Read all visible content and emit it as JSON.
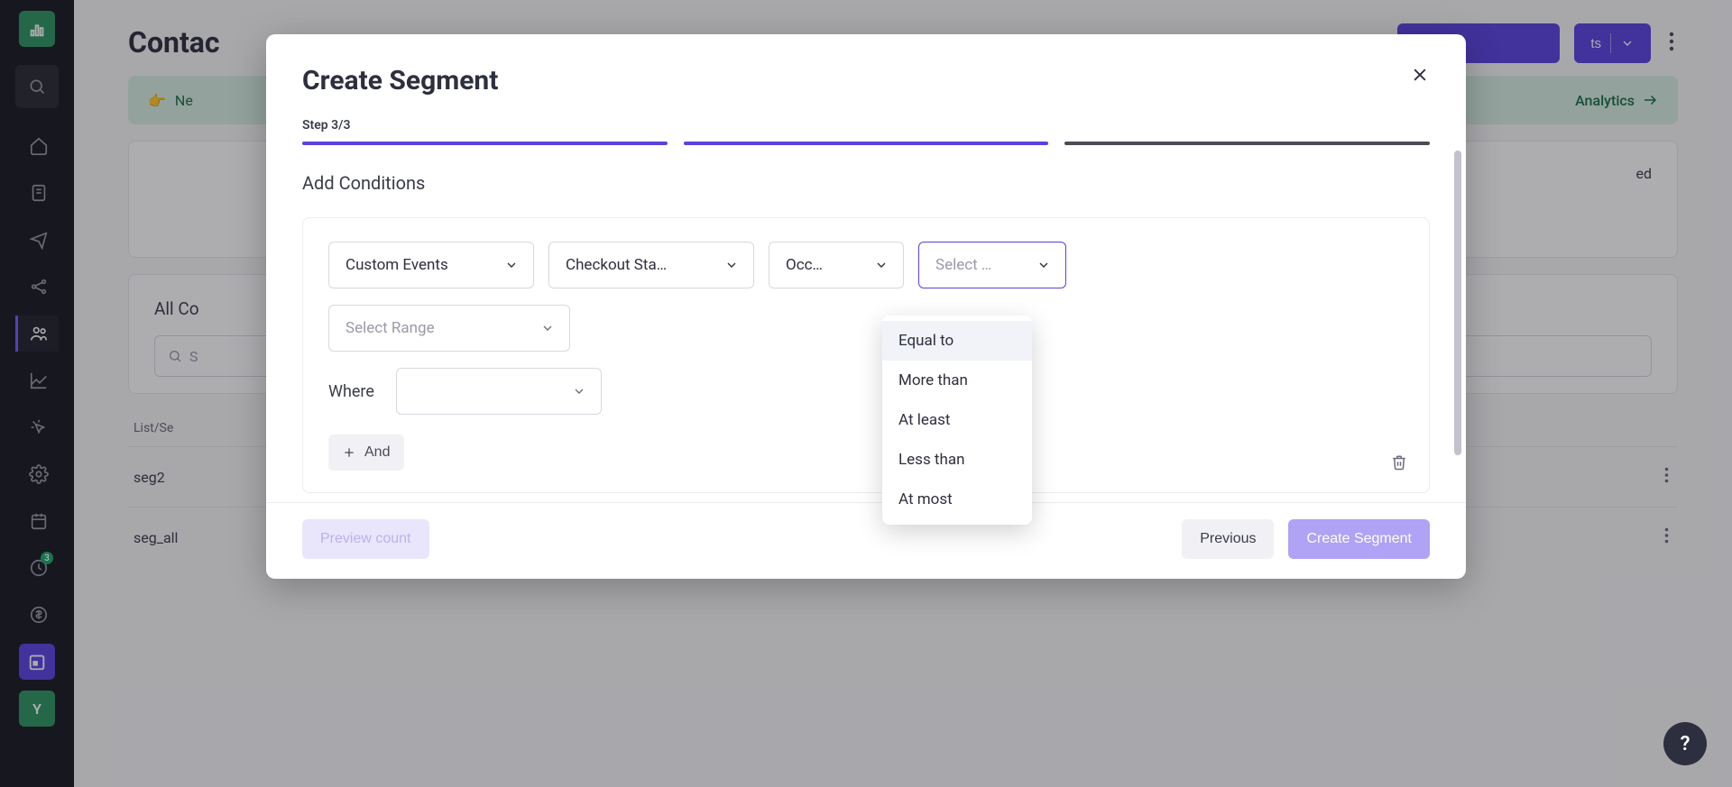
{
  "sidebar": {
    "notification_count": "3",
    "avatar_letter": "Y"
  },
  "page": {
    "title": "Contac",
    "banner_left": "Ne",
    "banner_right": "Analytics",
    "card_field_right": "ed",
    "filter_head": "All Co",
    "search_placeholder": "S",
    "table_header": "List/Se",
    "rows": [
      "seg2",
      "seg_all"
    ],
    "btn_split_label": "ts"
  },
  "modal": {
    "title": "Create Segment",
    "step_label": "Step 3/3",
    "section_title": "Add Conditions",
    "selects": {
      "event_type": "Custom Events",
      "event_name": "Checkout Sta…",
      "occurrence": "Occ…",
      "operator_placeholder": "Select …",
      "range_placeholder": "Select Range",
      "where_label": "Where"
    },
    "and_label": "And",
    "dropdown_options": [
      "Equal to",
      "More than",
      "At least",
      "Less than",
      "At most"
    ],
    "footer": {
      "preview": "Preview count",
      "previous": "Previous",
      "create": "Create Segment"
    }
  },
  "fab": "?"
}
